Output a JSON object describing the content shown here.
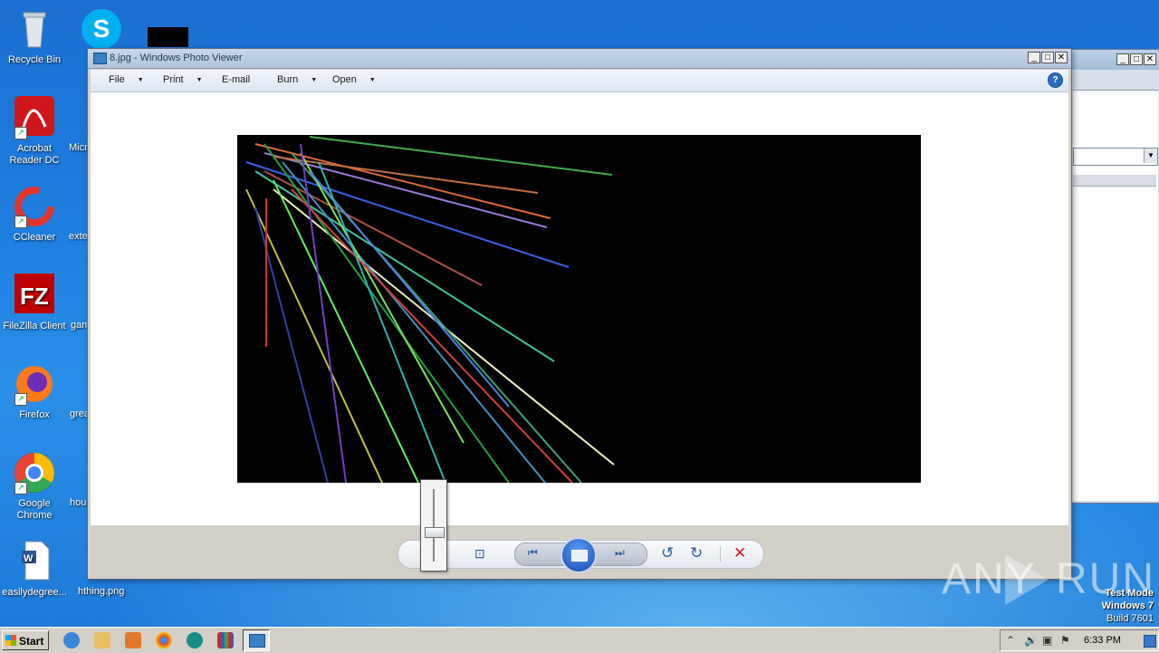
{
  "desktop": {
    "icons": [
      {
        "label": "Recycle Bin",
        "icon": "recycle-bin-icon"
      },
      {
        "label": "Acrobat Reader DC",
        "icon": "acrobat-icon"
      },
      {
        "label": "CCleaner",
        "icon": "ccleaner-icon"
      },
      {
        "label": "FileZilla Client",
        "icon": "filezilla-icon"
      },
      {
        "label": "Firefox",
        "icon": "firefox-icon"
      },
      {
        "label": "Google Chrome",
        "icon": "chrome-icon"
      },
      {
        "label": "easilydegree...",
        "icon": "word-doc-icon"
      }
    ],
    "partial_labels": [
      "Micr",
      "exte",
      "gam",
      "grea",
      "hou",
      "hthing.png"
    ]
  },
  "window": {
    "title": "8.jpg - Windows Photo Viewer",
    "menu": [
      "File",
      "Print",
      "E-mail",
      "Burn",
      "Open"
    ]
  },
  "watermark": {
    "brand_left": "ANY",
    "brand_right": "RUN"
  },
  "os_info": {
    "line1": "Test Mode",
    "line2": "Windows 7",
    "line3": "Build 7601"
  },
  "taskbar": {
    "start_label": "Start",
    "clock": "6:33 PM"
  },
  "colors": {
    "desktop": "#1e7ee0",
    "title_bar": "#b0c4dc",
    "photo_bg": "#000000",
    "delete": "#cc1a1a"
  }
}
